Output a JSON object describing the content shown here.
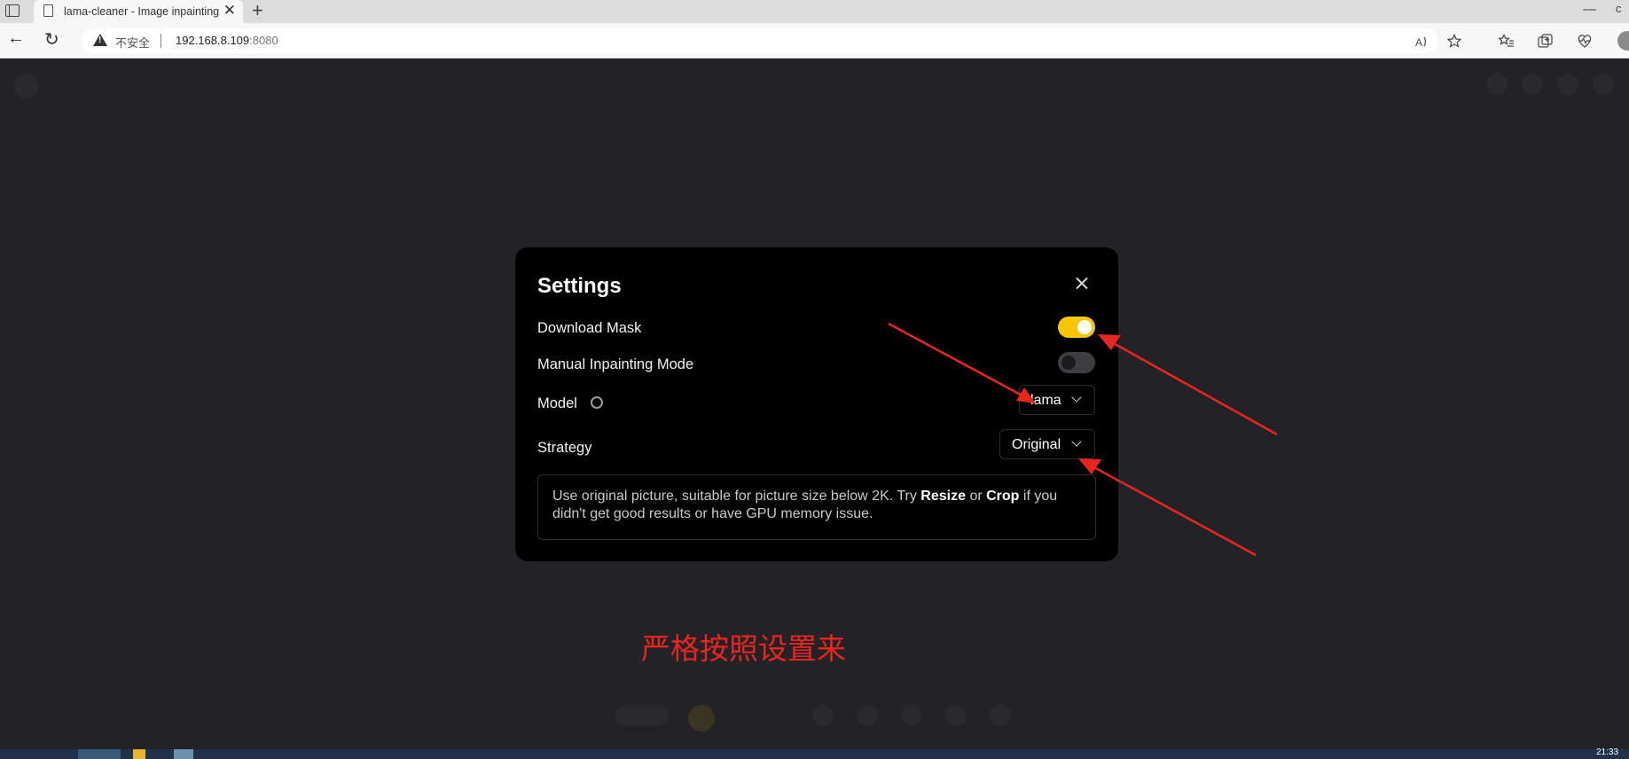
{
  "browser": {
    "tab_title": "lama-cleaner - Image inpainting",
    "tab_close": "✕",
    "new_tab": "+",
    "minimize": "—",
    "edge_partial": "c",
    "security_label": "不安全",
    "url_host": "192.168.8.109",
    "url_port": ":8080",
    "back_glyph": "←",
    "reload_glyph": "↻",
    "action_icons": [
      "read-aloud-icon",
      "favorite-star-icon",
      "favorites-list-icon",
      "collections-icon",
      "performance-icon",
      "profile-icon"
    ]
  },
  "settings": {
    "title": "Settings",
    "rows": {
      "download_mask": {
        "label": "Download Mask",
        "enabled": true
      },
      "manual_inpainting": {
        "label": "Manual Inpainting Mode",
        "enabled": false
      },
      "model": {
        "label": "Model",
        "value": "lama"
      },
      "strategy": {
        "label": "Strategy",
        "value": "Original"
      }
    },
    "description": {
      "part1": "Use original picture, suitable for picture size below 2K. Try ",
      "resize": "Resize",
      "part2": " or ",
      "crop": "Crop",
      "part3": " if you didn't get good results or have GPU memory issue."
    }
  },
  "annotation": {
    "note": "严格按照设置来",
    "arrow_color": "#e8261f"
  },
  "colors": {
    "toggle_on": "#f6c700",
    "toggle_off": "#3e3e42",
    "modal_bg": "#000000",
    "app_bg": "#232327"
  },
  "taskbar": {
    "clock": "21:33"
  }
}
